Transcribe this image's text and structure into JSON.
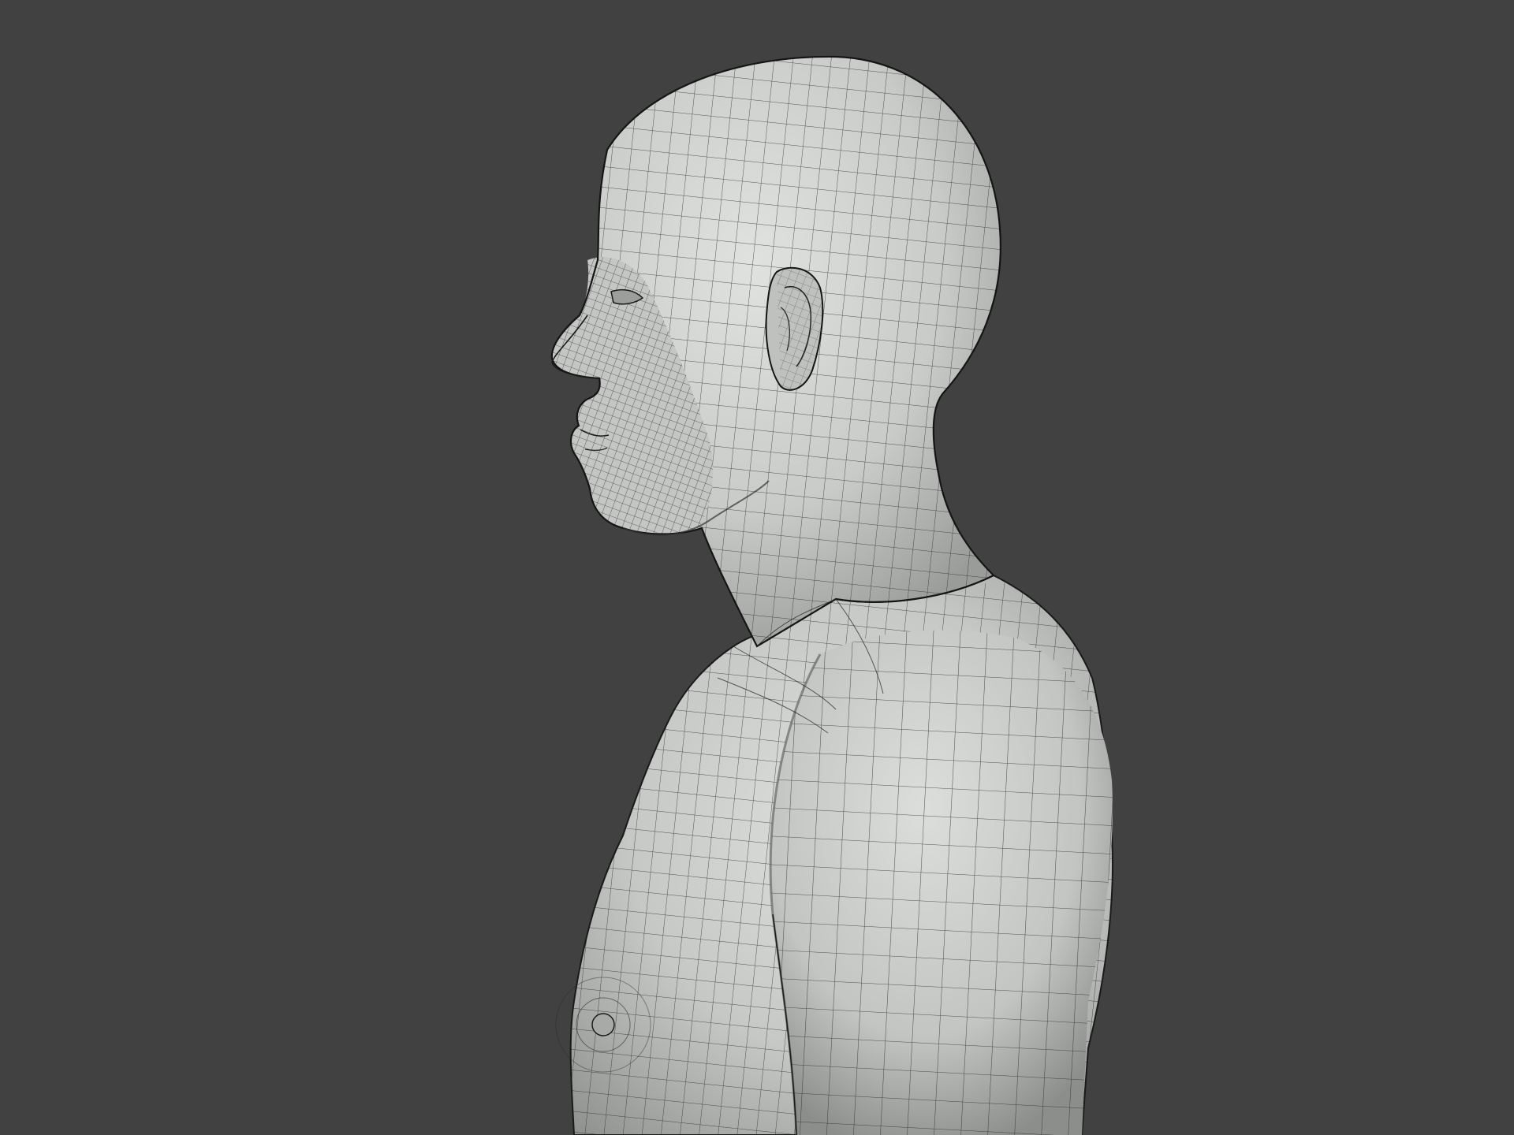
{
  "scene": {
    "background_color": "#414141",
    "mesh_fill_color": "#c9cbc9",
    "mesh_highlight_color": "#dcdedc",
    "mesh_shadow_color": "#8e908e",
    "wireframe_color": "#1f1f1f",
    "subject": "wireframe-male-bust-side-view-icon"
  }
}
